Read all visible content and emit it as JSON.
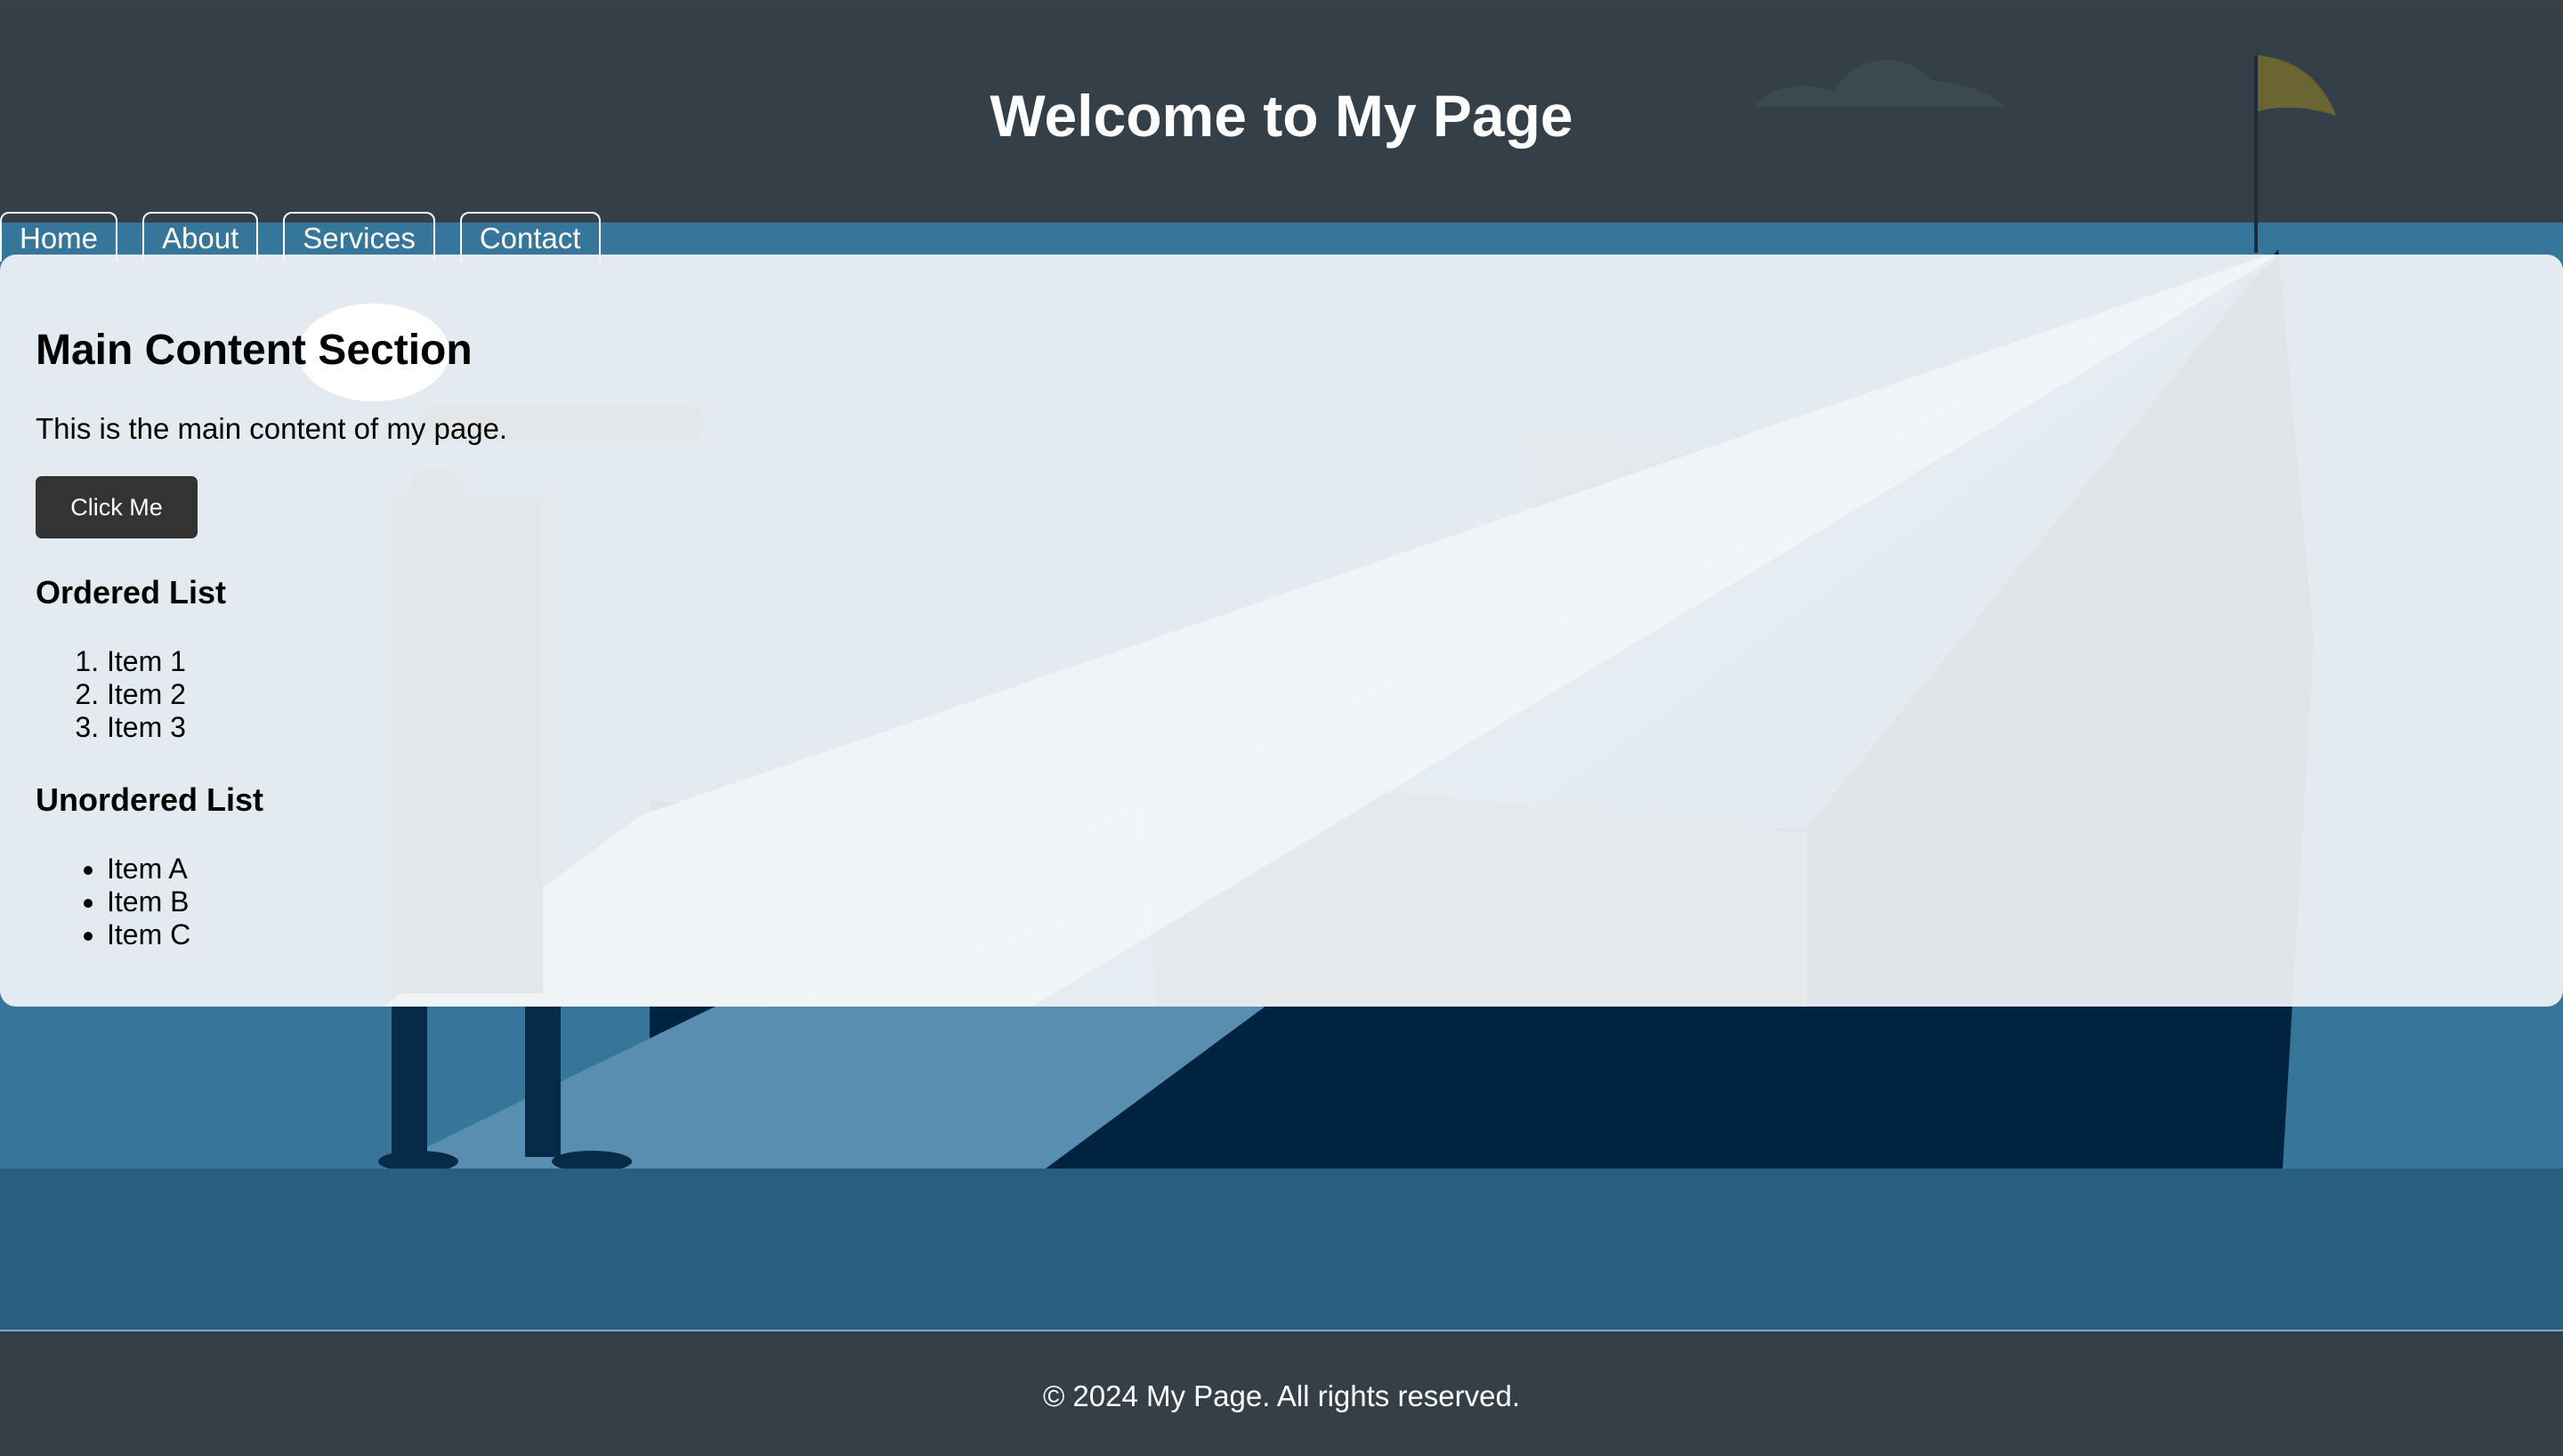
{
  "header": {
    "title": "Welcome to My Page"
  },
  "nav": {
    "items": [
      {
        "label": "Home"
      },
      {
        "label": "About"
      },
      {
        "label": "Services"
      },
      {
        "label": "Contact"
      }
    ]
  },
  "main": {
    "title": "Main Content Section",
    "intro": "This is the main content of my page.",
    "button_label": "Click Me",
    "ordered_list": {
      "title": "Ordered List",
      "items": [
        "Item 1",
        "Item 2",
        "Item 3"
      ]
    },
    "unordered_list": {
      "title": "Unordered List",
      "items": [
        "Item A",
        "Item B",
        "Item C"
      ]
    }
  },
  "footer": {
    "text": "© 2024 My Page. All rights reserved."
  },
  "colors": {
    "header_bg": "#343f48",
    "page_bg": "#36769a",
    "button_bg": "#333333",
    "band": "#275e82",
    "flag": "#6b6433"
  },
  "illustration": {
    "icons": [
      "cloud-icon",
      "flag-icon",
      "person-with-telescope-icon",
      "speech-bubble-icon",
      "zigzag-path-icon"
    ]
  }
}
